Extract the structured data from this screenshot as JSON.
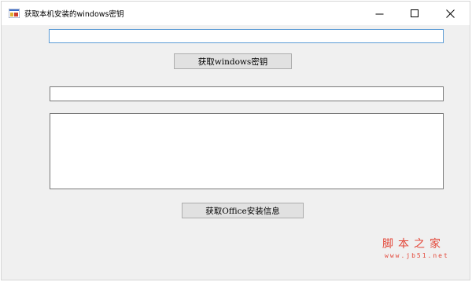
{
  "window": {
    "title": "获取本机安装的windows密钥",
    "icon": "app-window-icon"
  },
  "controls": {
    "minimize_icon": "minimize-icon",
    "maximize_icon": "maximize-icon",
    "close_icon": "close-icon"
  },
  "form": {
    "windows_key_value": "",
    "get_windows_key_label": "获取windows密钥",
    "office_line_value": "",
    "office_info_value": "",
    "get_office_info_label": "获取Office安装信息"
  },
  "watermark": {
    "site_name": "脚本之家",
    "url": "www.jb51.net"
  },
  "colors": {
    "window_bg": "#f0f0f0",
    "titlebar_bg": "#ffffff",
    "focus_border": "#5b9bd5",
    "button_bg": "#e1e1e1",
    "watermark": "#e3483a"
  }
}
